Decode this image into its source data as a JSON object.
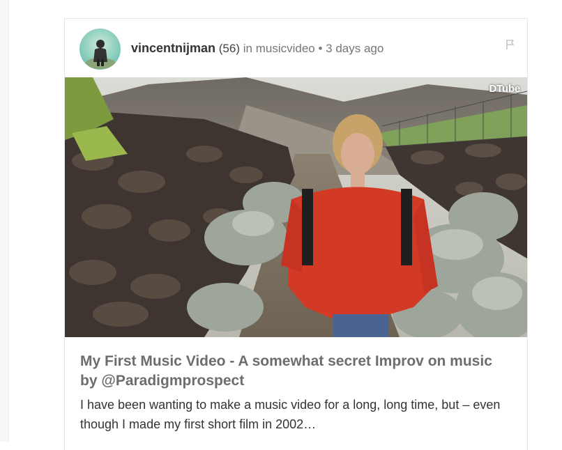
{
  "post": {
    "author": "vincentnijman",
    "reputation": "(56)",
    "in_label": "in",
    "category": "musicvideo",
    "separator": "•",
    "timestamp": "3 days ago",
    "title": "My First Music Video - A somewhat secret Improv on music by @Paradigmprospect",
    "summary": "I have been wanting to make a music video for a long, long time, but – even though I made my first short film in 2002…",
    "thumbnail_badge": "DTube"
  },
  "icons": {
    "avatar": "avatar",
    "flag": "flag-icon",
    "dtube_logo": "dtube-logo-icon"
  },
  "colors": {
    "author": "#333333",
    "meta": "#777777",
    "title": "#6d6d6d",
    "summary": "#333333",
    "card_border": "#e6e6e6"
  }
}
